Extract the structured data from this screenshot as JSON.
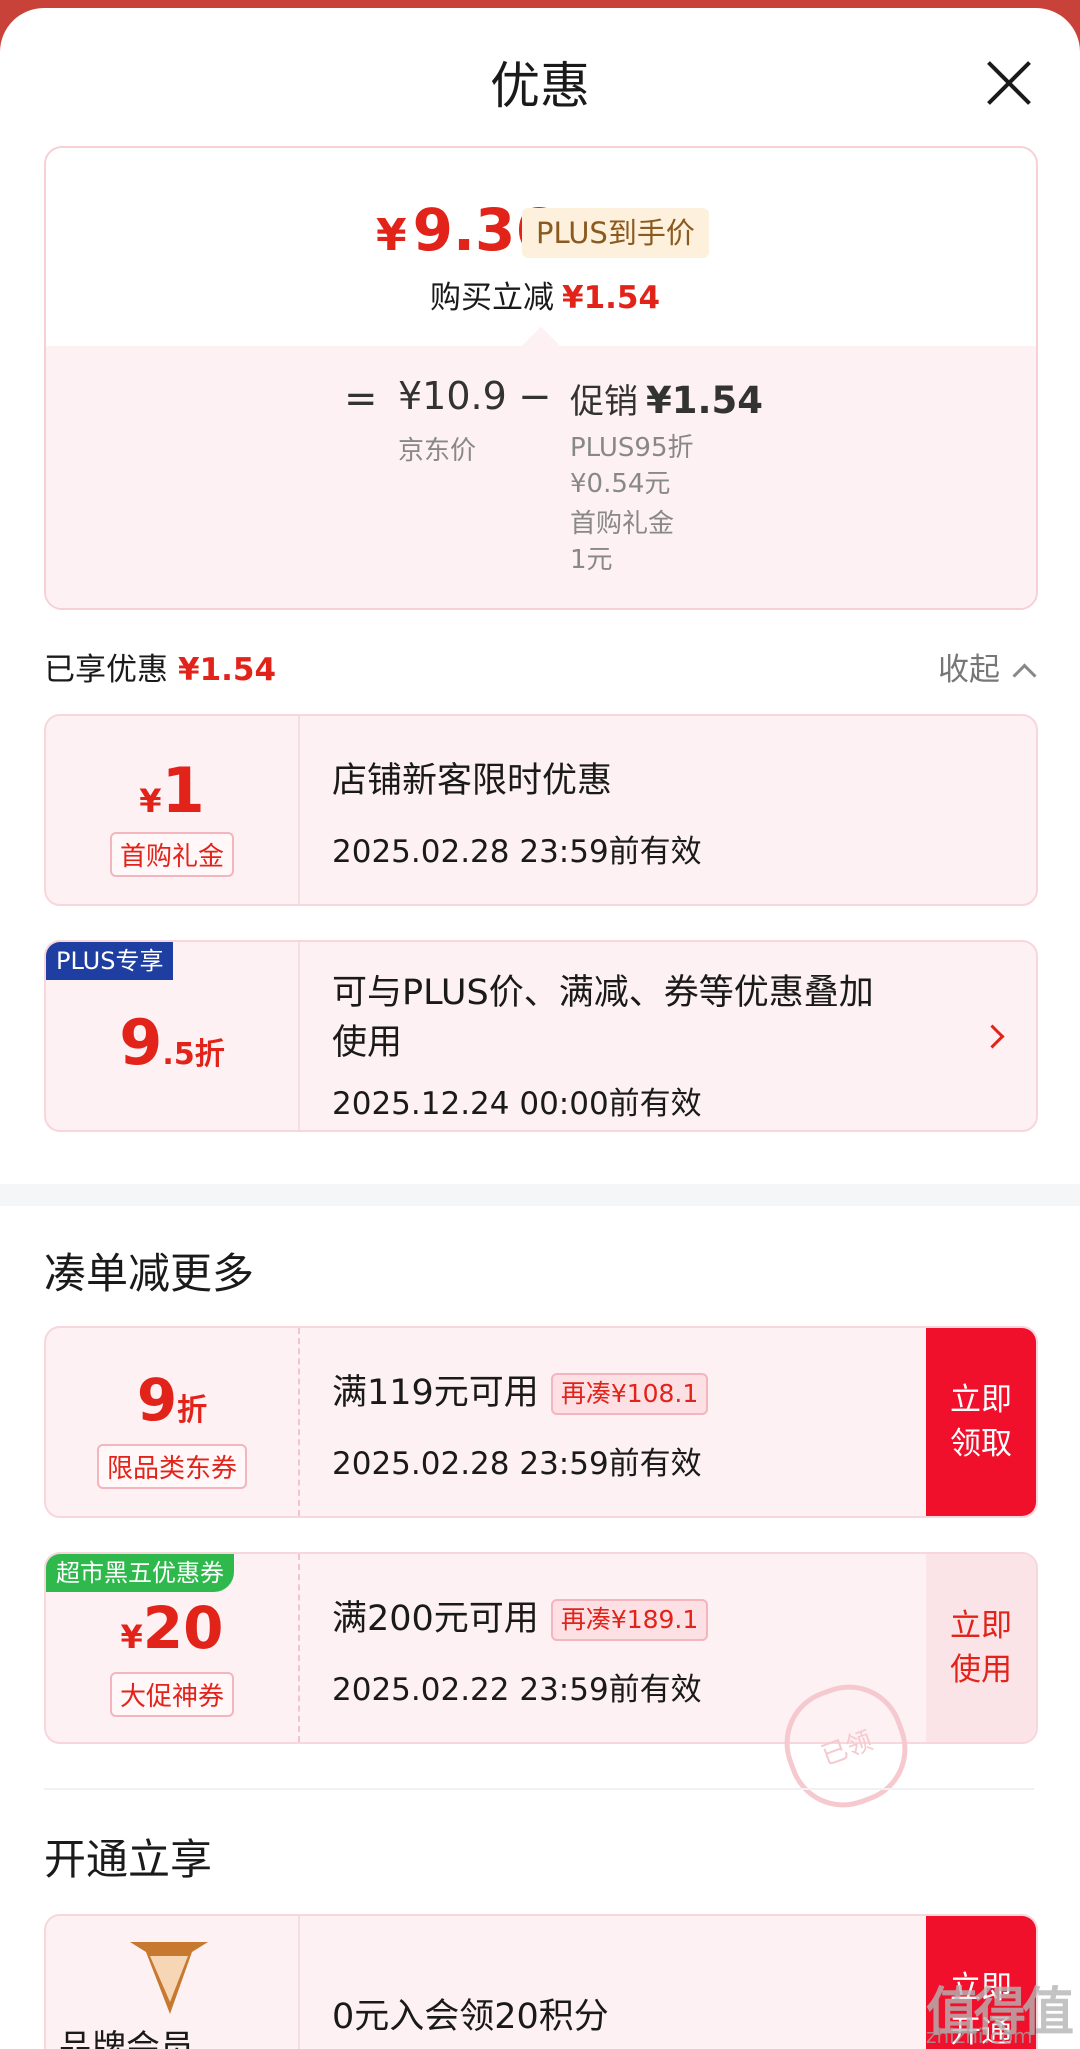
{
  "sheet": {
    "title": "优惠"
  },
  "summary": {
    "final_price": "9.36",
    "currency": "¥",
    "plus_tag": "PLUS到手价",
    "buy_reduce_label": "购买立减",
    "buy_reduce_value": "¥1.54",
    "equals": "=",
    "jd_price": "¥10.9",
    "jd_price_label": "京东价",
    "minus": "−",
    "promo_label": "促销",
    "promo_value": "¥1.54",
    "promo_detail_1": [
      "PLUS95折",
      "¥0.54元"
    ],
    "promo_detail_2": [
      "首购礼金",
      "1元"
    ]
  },
  "enjoyed": {
    "label": "已享优惠",
    "value": "¥1.54",
    "collapse": "收起"
  },
  "enjoyed_coupons": [
    {
      "amount_prefix": "¥",
      "amount": "1",
      "sub": "首购礼金",
      "title": "店铺新客限时优惠",
      "date": "2025.02.28 23:59前有效"
    },
    {
      "corner": "PLUS专享",
      "amount": "9",
      "amount_suffix": ".5折",
      "title_line1": "可与PLUS价、满减、券等优惠叠加",
      "title_line2": "使用",
      "date": "2025.12.24 00:00前有效"
    }
  ],
  "more_section": {
    "title": "凑单减更多"
  },
  "more_coupons": [
    {
      "amount": "9",
      "amount_suffix": "折",
      "sub": "限品类东券",
      "title": "满119元可用",
      "tag": "再凑¥108.1",
      "date": "2025.02.28 23:59前有效",
      "action": [
        "立即",
        "领取"
      ]
    },
    {
      "corner": "超市黑五优惠券",
      "amount_prefix": "¥",
      "amount": "20",
      "sub": "大促神券",
      "title": "满200元可用",
      "tag": "再凑¥189.1",
      "date": "2025.02.22 23:59前有效",
      "action": [
        "立即",
        "使用"
      ],
      "stamp": "已领"
    }
  ],
  "open_section": {
    "title": "开通立享"
  },
  "open_coupon": {
    "brand_label": "品牌会员",
    "title": "0元入会领20积分",
    "action": [
      "立即",
      "开通"
    ]
  },
  "colors": {
    "accent": "#e2231a",
    "plus_blue": "#1e3ea1",
    "green_tag": "#2fb84c",
    "action_red": "#f0102b"
  },
  "watermark": {
    "main": "值得值",
    "sub": "zhizhi.com"
  }
}
